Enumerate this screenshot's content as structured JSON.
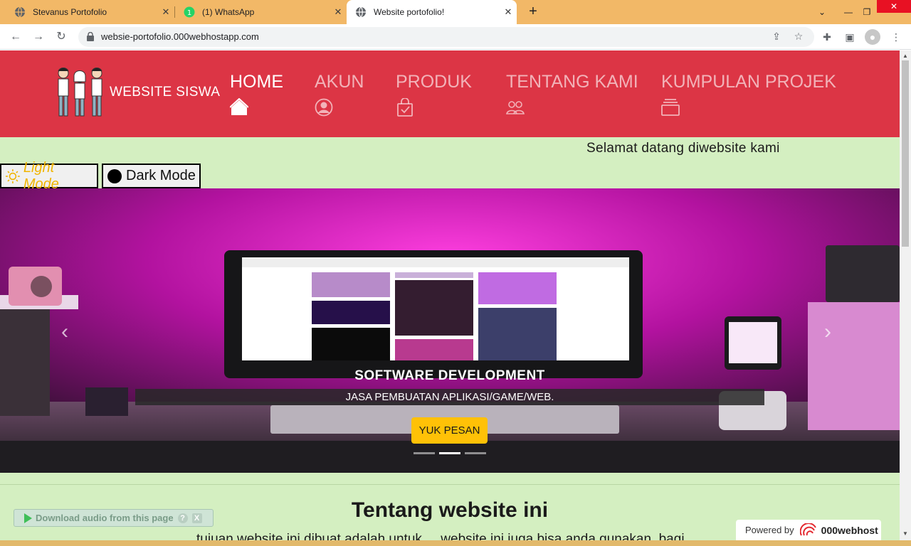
{
  "browser": {
    "tabs": [
      {
        "title": "Stevanus Portofolio"
      },
      {
        "title": "(1) WhatsApp",
        "badge": "1"
      },
      {
        "title": "Website portofolio!"
      }
    ],
    "url": "websie-portofolio.000webhostapp.com",
    "accent": "#f2b867"
  },
  "site": {
    "brand": "WEBSITE SISWA",
    "nav": [
      {
        "label": "HOME",
        "icon": "home-icon"
      },
      {
        "label": "AKUN",
        "icon": "person-circle-icon"
      },
      {
        "label": "PRODUK",
        "icon": "bag-check-icon"
      },
      {
        "label": "TENTANG KAMI",
        "icon": "people-icon"
      },
      {
        "label": "KUMPULAN PROJEK",
        "icon": "collection-icon"
      }
    ],
    "welcome": "Selamat datang diwebsite kami",
    "light_mode": "Light Mode",
    "dark_mode": "Dark Mode",
    "carousel": {
      "title": "SOFTWARE DEVELOPMENT",
      "subtitle": "JASA PEMBUATAN APLIKASI/GAME/WEB.",
      "button": "YUK PESAN",
      "slides": 3,
      "active_slide": 2
    },
    "about_title": "Tentang website ini",
    "about_text": "tujuan website ini dibuat adalah untuk ... website ini juga bisa anda gunakan, bagi",
    "download_audio": "Download audio from this page",
    "powered_by": "Powered by",
    "host": "000webhost",
    "colors": {
      "navbar": "#dc3545",
      "page_bg": "#d4efc1",
      "button": "#ffc107"
    }
  }
}
